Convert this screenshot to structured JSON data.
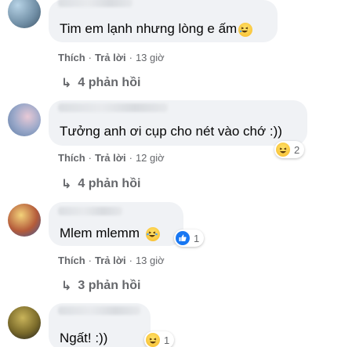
{
  "comments": [
    {
      "text": "Tim em lạnh nhưng lòng e ấm",
      "actions": {
        "like": "Thích",
        "reply": "Trả lời",
        "time": "13 giờ"
      },
      "replies": "4 phản hồi",
      "reaction_count": null
    },
    {
      "text": "Tưởng anh ơi cụp cho nét vào chớ :))",
      "actions": {
        "like": "Thích",
        "reply": "Trả lời",
        "time": "12 giờ"
      },
      "replies": "4 phản hồi",
      "reaction_count": "2"
    },
    {
      "text": "Mlem mlemm",
      "actions": {
        "like": "Thích",
        "reply": "Trả lời",
        "time": "13 giờ"
      },
      "replies": "3 phản hồi",
      "reaction_count": "1"
    },
    {
      "text": "Ngất! :))",
      "reaction_count": "1"
    }
  ],
  "separator": "·",
  "reply_arrow": "↳",
  "colors": {
    "bubble": "#f0f2f5",
    "meta": "#65676b",
    "text": "#050505",
    "like": "#1877f2",
    "haha": "#f7b928"
  },
  "icons": [
    "haha-emoji-icon",
    "like-icon",
    "reply-arrow-icon"
  ]
}
